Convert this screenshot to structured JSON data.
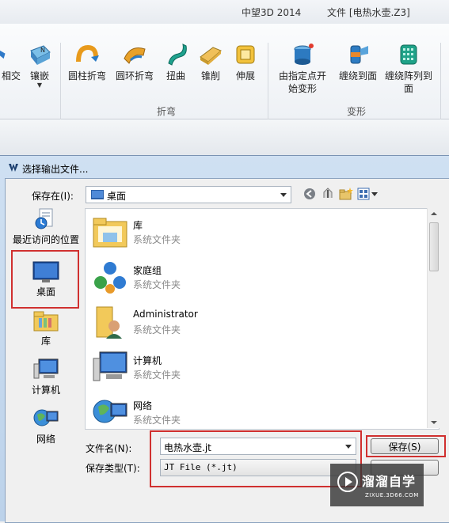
{
  "app": {
    "title": "中望3D 2014",
    "document_title": "文件 [电热水壶.Z3]"
  },
  "ribbon": {
    "buttons": [
      {
        "label": "相交",
        "icon": "intersect-icon"
      },
      {
        "label": "镶嵌",
        "icon": "emboss-icon"
      },
      {
        "label": "圆柱折弯",
        "icon": "cylinder-bend-icon"
      },
      {
        "label": "圆环折弯",
        "icon": "torus-bend-icon"
      },
      {
        "label": "扭曲",
        "icon": "twist-icon"
      },
      {
        "label": "锥削",
        "icon": "taper-icon"
      },
      {
        "label": "伸展",
        "icon": "stretch-icon"
      },
      {
        "label": "由指定点开始变形",
        "label_line1": "由指定点开",
        "label_line2": "始变形",
        "icon": "point-deform-icon"
      },
      {
        "label": "缠绕到面",
        "icon": "wrap-to-face-icon"
      },
      {
        "label": "缠绕阵列到面",
        "label_line1": "缠绕阵列到",
        "label_line2": "面",
        "icon": "wrap-array-icon"
      }
    ],
    "groups": {
      "bend": "折弯",
      "deform": "变形"
    }
  },
  "dialog": {
    "title": "选择输出文件...",
    "save_in_label": "保存在(I):",
    "save_in_value": "桌面",
    "places": [
      {
        "label": "最近访问的位置",
        "icon": "recent-places-icon"
      },
      {
        "label": "桌面",
        "icon": "desktop-icon",
        "selected": true
      },
      {
        "label": "库",
        "icon": "libraries-icon"
      },
      {
        "label": "计算机",
        "icon": "computer-icon"
      },
      {
        "label": "网络",
        "icon": "network-icon"
      }
    ],
    "files": [
      {
        "name": "库",
        "type": "系统文件夹",
        "icon": "libraries-folder-icon"
      },
      {
        "name": "家庭组",
        "type": "系统文件夹",
        "icon": "homegroup-icon"
      },
      {
        "name": "Administrator",
        "type": "系统文件夹",
        "icon": "user-folder-icon"
      },
      {
        "name": "计算机",
        "type": "系统文件夹",
        "icon": "computer-icon"
      },
      {
        "name": "网络",
        "type": "系统文件夹",
        "icon": "network-icon"
      }
    ],
    "file_name_label": "文件名(N):",
    "file_name_value": "电热水壶.jt",
    "file_type_label": "保存类型(T):",
    "file_type_value": "JT File (*.jt)",
    "save_button": "保存(S)"
  },
  "watermark": {
    "brand": "溜溜自学",
    "url": "ZIXUE.3D66.COM"
  },
  "colors": {
    "highlight_red": "#d0302f",
    "dialog_frame": "#c3d7ee"
  }
}
